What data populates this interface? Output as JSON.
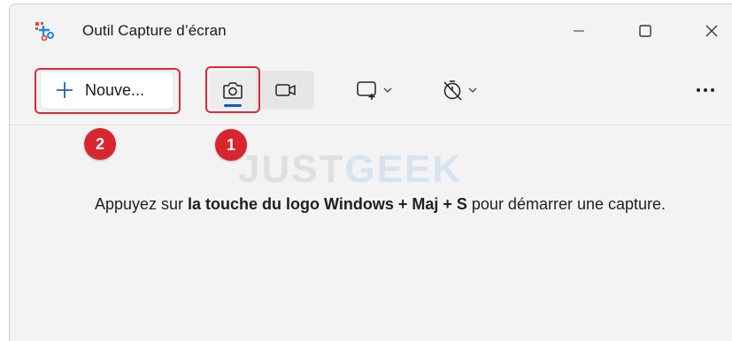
{
  "window": {
    "title": "Outil Capture d’écran",
    "icon": "snipping-tool-icon",
    "controls": [
      "minimize-icon",
      "maximize-icon",
      "close-icon"
    ]
  },
  "toolbar": {
    "new_label": "Nouve...",
    "new_icon": "plus-icon",
    "modes": [
      {
        "icon": "camera-icon",
        "selected": true
      },
      {
        "icon": "video-camera-icon",
        "selected": false
      }
    ],
    "snip_shape_icon": "rectangle-snip-icon",
    "timer_icon": "no-delay-timer-icon",
    "more_icon": "more-options-icon"
  },
  "annotations": {
    "badge_1": "1",
    "badge_2": "2",
    "highlight_color": "#d92a3a"
  },
  "watermark": {
    "part1": "JUST",
    "part2": "GEEK"
  },
  "content": {
    "text_before": "Appuyez sur ",
    "text_bold": "la touche du logo Windows + Maj + S",
    "text_after": " pour démarrer une capture."
  },
  "colors": {
    "accent": "#0a5ec7",
    "badge": "#d8262f",
    "background": "#f3f3f3"
  }
}
